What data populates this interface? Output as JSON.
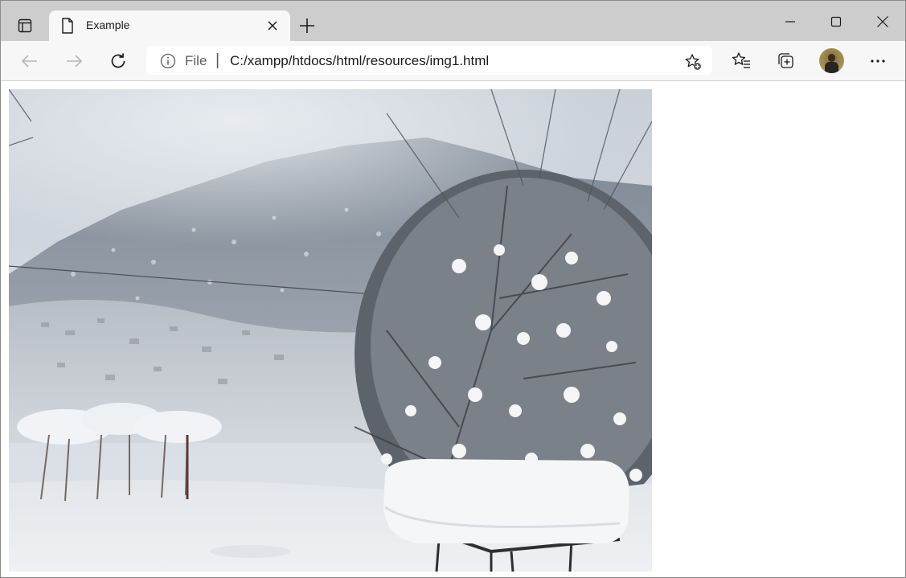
{
  "tab": {
    "title": "Example"
  },
  "address_bar": {
    "scheme_label": "File",
    "separator": "|",
    "url": "C:/xampp/htdocs/html/resources/img1.html"
  },
  "icons": {
    "tab_actions": "tab-actions-icon",
    "favicon": "document-icon",
    "close_tab": "close-icon",
    "new_tab": "plus-icon",
    "minimize": "minimize-icon",
    "maximize": "maximize-icon",
    "close_window": "close-icon",
    "back": "arrow-left-icon",
    "forward": "arrow-right-icon",
    "refresh": "refresh-icon",
    "site_info": "info-icon",
    "add_favorite": "star-add-icon",
    "favorites": "favorites-icon",
    "collections": "collections-icon",
    "profile": "avatar",
    "more": "more-icon"
  },
  "image": {
    "subject": "snow-covered mountain valley with snowy trees and a snow-covered table"
  },
  "colors": {
    "tabstrip": "#cdcdcd",
    "toolbar": "#f7f7f7",
    "disabled_icon": "#b5b5b5",
    "icon": "#1b1b1b"
  }
}
